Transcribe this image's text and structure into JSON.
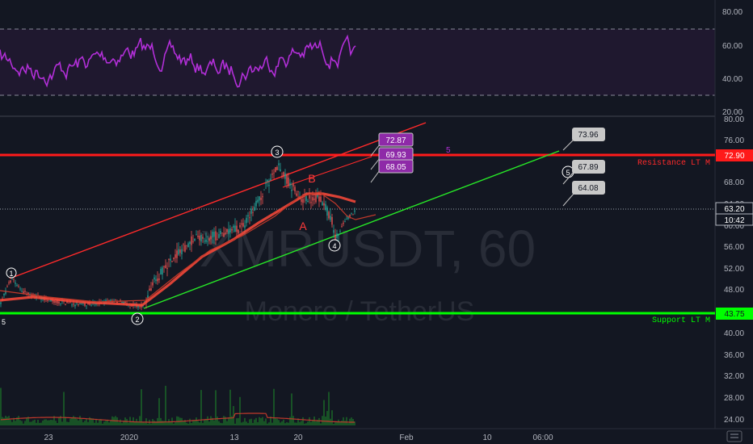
{
  "colors": {
    "background": "#131722",
    "grid": "#1e222d",
    "rsi_line": "#b22fd8",
    "rsi_band": "#2a1a3a",
    "price_line": "#c0392b",
    "ma_line": "#ff4a3a",
    "resistance": "#ff1a1a",
    "support": "#00ff00",
    "trend_up_green": "#27e827",
    "channel_red": "#ff2a2a",
    "volume": "#1b7a2a",
    "label_box": "#c8c8c8",
    "target_box": "#8e2aa8"
  },
  "watermark": {
    "symbol": "XMRUSDT, 60",
    "description": "Monero / TetherUS"
  },
  "rsi_axis": {
    "ticks": [
      "80.00",
      "60.00",
      "40.00",
      "20.00"
    ]
  },
  "price_axis": {
    "ticks": [
      "80.00",
      "76.00",
      "72.00",
      "68.00",
      "64.00",
      "60.00",
      "56.00",
      "52.00",
      "48.00",
      "44.00",
      "40.00",
      "36.00",
      "32.00",
      "28.00",
      "24.00"
    ],
    "last_price": "63.20",
    "countdown": "10:42",
    "resistance_price": "72.90",
    "support_price": "43.75"
  },
  "time_axis": {
    "ticks": [
      "23",
      "2020",
      "13",
      "20",
      "Feb",
      "10",
      "06:00"
    ]
  },
  "levels": {
    "resistance_label": "Resistance LT M",
    "support_label": "Support LT M"
  },
  "waves": {
    "w1": "1",
    "w2": "2",
    "w3": "3",
    "w4": "4",
    "w5": "5",
    "w5b": "5",
    "wA": "A",
    "wB": "B",
    "w5_left": "5"
  },
  "targets": {
    "purple": [
      "72.87",
      "69.93",
      "68.05"
    ],
    "gray": [
      "73.96",
      "67.89",
      "64.08"
    ]
  },
  "icons": {
    "price_scale": "price-scale-icon"
  }
}
